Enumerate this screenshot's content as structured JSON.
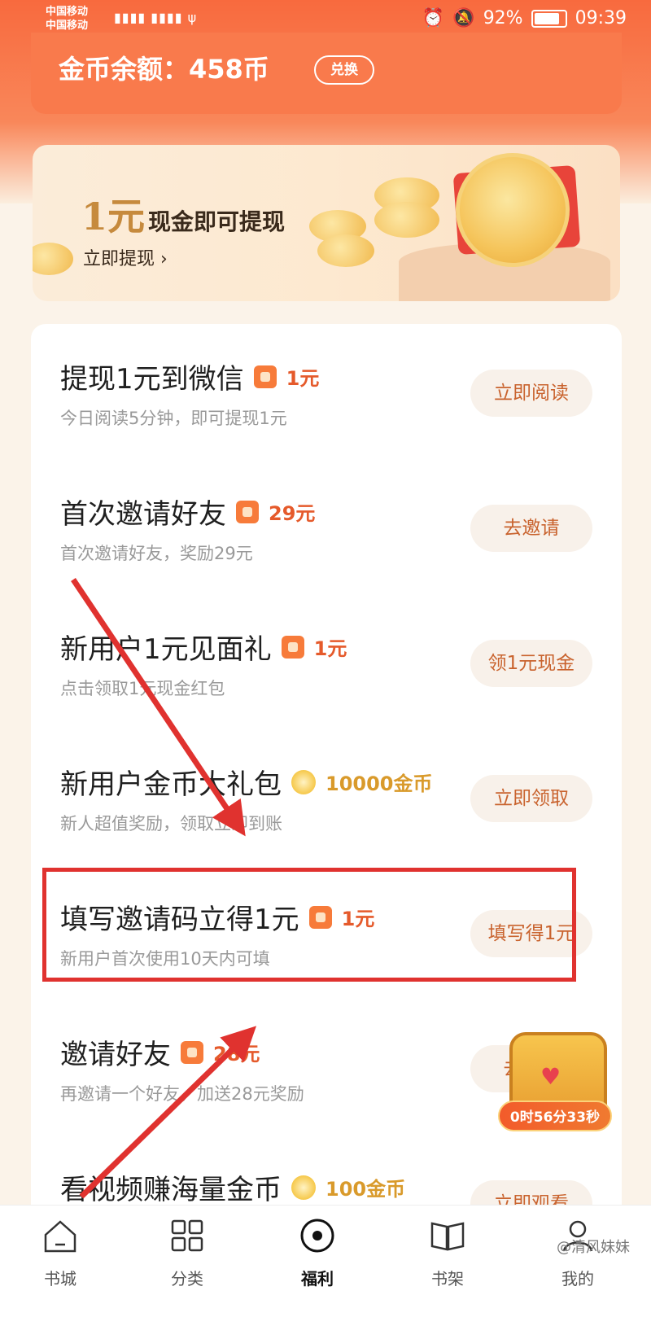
{
  "status_bar": {
    "carrier1": "中国移动",
    "carrier2": "中国移动",
    "battery": "92%",
    "time": "09:39"
  },
  "balance": {
    "text": "金币余额：458币",
    "exchange_label": "兑换"
  },
  "banner": {
    "amount": "1元",
    "title": "现金即可提现",
    "link": "立即提现 ›"
  },
  "tasks": [
    {
      "title": "提现1元到微信",
      "reward_type": "cash",
      "reward": "1元",
      "desc": "今日阅读5分钟，即可提现1元",
      "button": "立即阅读"
    },
    {
      "title": "首次邀请好友",
      "reward_type": "cash",
      "reward": "29元",
      "desc": "首次邀请好友，奖励29元",
      "button": "去邀请"
    },
    {
      "title": "新用户1元见面礼",
      "reward_type": "cash",
      "reward": "1元",
      "desc": "点击领取1元现金红包",
      "button": "领1元现金"
    },
    {
      "title": "新用户金币大礼包",
      "reward_type": "coin",
      "reward": "10000金币",
      "desc": "新人超值奖励，领取立即到账",
      "button": "立即领取"
    },
    {
      "title": "填写邀请码立得1元",
      "reward_type": "cash",
      "reward": "1元",
      "desc": "新用户首次使用10天内可填",
      "button": "填写得1元"
    },
    {
      "title": "邀请好友",
      "reward_type": "cash",
      "reward": "28元",
      "desc": "再邀请一个好友，加送28元奖励",
      "button": "去邀请"
    },
    {
      "title": "看视频赚海量金币",
      "reward_type": "coin",
      "reward": "100金币",
      "desc": "",
      "button": "立即观看"
    }
  ],
  "chest": {
    "timer": "0时56分33秒"
  },
  "tabbar": {
    "items": [
      {
        "label": "书城",
        "icon": "home-icon"
      },
      {
        "label": "分类",
        "icon": "grid-icon"
      },
      {
        "label": "福利",
        "icon": "target-icon",
        "active": true
      },
      {
        "label": "书架",
        "icon": "book-icon"
      },
      {
        "label": "我的",
        "icon": "person-icon"
      }
    ]
  },
  "watermark": "@清风妹妹",
  "colors": {
    "accent": "#f86a3e",
    "reward": "#e55a2b",
    "highlight": "#e0322f"
  }
}
